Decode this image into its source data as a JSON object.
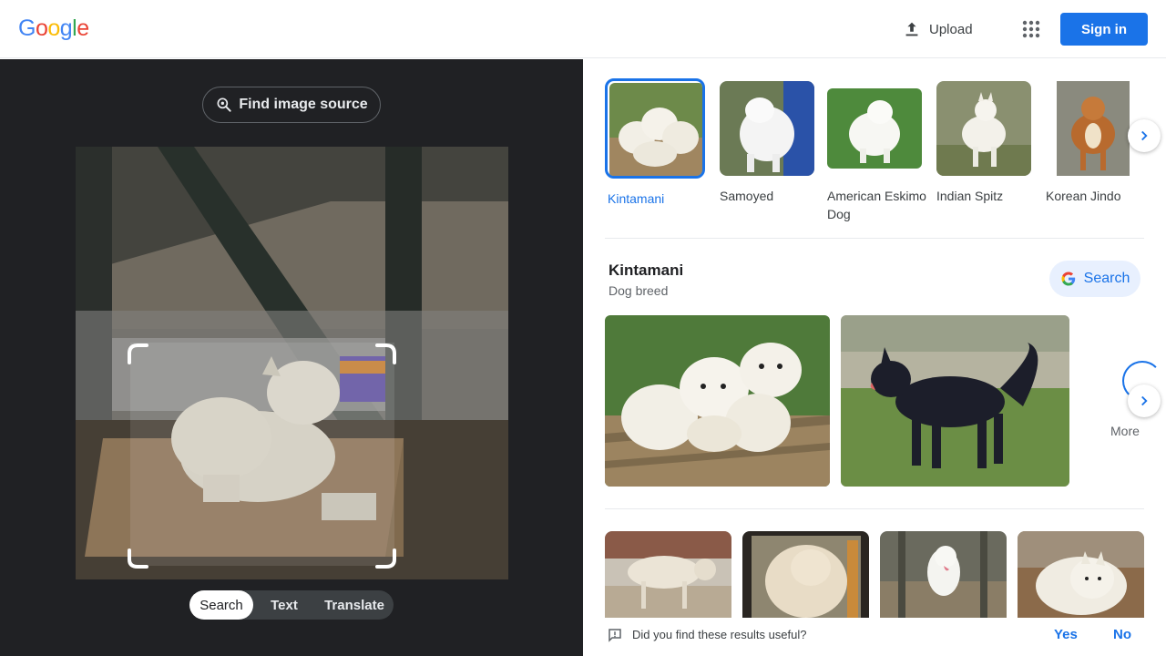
{
  "header": {
    "logo_letters": [
      "G",
      "o",
      "o",
      "g",
      "l",
      "e"
    ],
    "logo_colors": [
      "#4285f4",
      "#ea4335",
      "#fbbc05",
      "#4285f4",
      "#34a853",
      "#ea4335"
    ],
    "upload_label": "Upload",
    "apps_icon": "apps-grid-icon",
    "signin_label": "Sign in"
  },
  "lens": {
    "find_source_label": "Find image source",
    "modes": [
      {
        "label": "Search",
        "active": true
      },
      {
        "label": "Text",
        "active": false
      },
      {
        "label": "Translate",
        "active": false
      }
    ]
  },
  "breeds": [
    {
      "name": "Kintamani",
      "selected": true
    },
    {
      "name": "Samoyed",
      "selected": false
    },
    {
      "name": "American Eskimo Dog",
      "selected": false
    },
    {
      "name": "Indian Spitz",
      "selected": false
    },
    {
      "name": "Korean Jindo",
      "selected": false
    }
  ],
  "knowledge": {
    "title": "Kintamani",
    "subtitle": "Dog breed",
    "search_label": "Search",
    "more_label": "More"
  },
  "feedback": {
    "question": "Did you find these results useful?",
    "yes": "Yes",
    "no": "No"
  },
  "colors": {
    "accent": "#1a73e8",
    "dark_bg": "#202124"
  }
}
